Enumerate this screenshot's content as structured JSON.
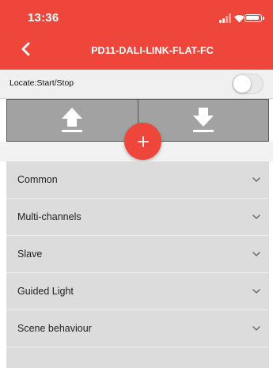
{
  "status_bar": {
    "time": "13:36",
    "icons": [
      "signal-icon",
      "wifi-icon",
      "battery-icon"
    ]
  },
  "header": {
    "title": "PD11-DALI-LINK-FLAT-FC",
    "back_icon": "chevron-left-icon",
    "background_color": "#ee463b"
  },
  "locate": {
    "label": "Locate:Start/Stop",
    "toggle_on": false
  },
  "transfer": {
    "upload_icon": "upload-icon",
    "download_icon": "download-icon"
  },
  "add_button": {
    "icon": "plus-icon",
    "color": "#ee463b"
  },
  "sections": [
    {
      "label": "Common"
    },
    {
      "label": "Multi-channels"
    },
    {
      "label": "Slave"
    },
    {
      "label": "Guided Light"
    },
    {
      "label": "Scene behaviour"
    }
  ]
}
